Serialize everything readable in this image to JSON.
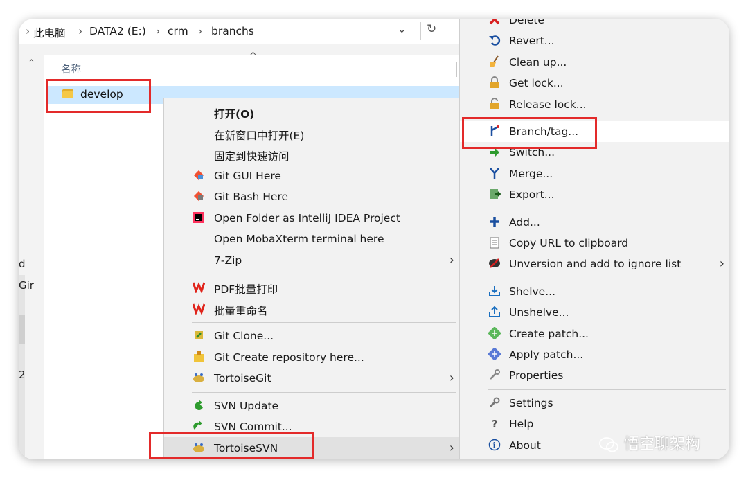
{
  "address_bar": {
    "segments": [
      "此电脑",
      "DATA2 (E:)",
      "crm",
      "branchs"
    ],
    "separator": "›",
    "dropdown_icon": "chevron-down-icon",
    "refresh_icon": "refresh-icon"
  },
  "file_list": {
    "column_name": "名称",
    "selected_item": "develop",
    "edge_chars": [
      "d",
      "Gir",
      "2"
    ]
  },
  "context_menu": {
    "groups": [
      [
        {
          "label": "打开(O)",
          "icon": "none",
          "bold": true
        },
        {
          "label": "在新窗口中打开(E)",
          "icon": "none"
        },
        {
          "label": "固定到快速访问",
          "icon": "none"
        },
        {
          "label": "Git GUI Here",
          "icon": "git-gui-icon"
        },
        {
          "label": "Git Bash Here",
          "icon": "git-bash-icon"
        },
        {
          "label": "Open Folder as IntelliJ IDEA Project",
          "icon": "intellij-icon"
        },
        {
          "label": "Open MobaXterm terminal here",
          "icon": "none"
        },
        {
          "label": "7-Zip",
          "icon": "none",
          "submenu": true
        }
      ],
      [
        {
          "label": "PDF批量打印",
          "icon": "wps-icon"
        },
        {
          "label": "批量重命名",
          "icon": "wps-icon"
        }
      ],
      [
        {
          "label": "Git Clone...",
          "icon": "tortoisegit-clone-icon"
        },
        {
          "label": "Git Create repository here...",
          "icon": "tortoisegit-repo-icon"
        },
        {
          "label": "TortoiseGit",
          "icon": "tortoisegit-icon",
          "submenu": true
        }
      ],
      [
        {
          "label": "SVN Update",
          "icon": "svn-update-icon"
        },
        {
          "label": "SVN Commit...",
          "icon": "svn-commit-icon"
        },
        {
          "label": "TortoiseSVN",
          "icon": "tortoisesvn-icon",
          "submenu": true,
          "highlighted": true
        }
      ]
    ]
  },
  "svn_submenu": {
    "groups": [
      [
        {
          "label": "Delete",
          "icon": "delete-icon"
        },
        {
          "label": "Revert...",
          "icon": "revert-icon"
        },
        {
          "label": "Clean up...",
          "icon": "cleanup-icon"
        },
        {
          "label": "Get lock...",
          "icon": "lock-icon"
        },
        {
          "label": "Release lock...",
          "icon": "unlock-icon"
        }
      ],
      [
        {
          "label": "Branch/tag...",
          "icon": "branch-icon",
          "highlighted": true
        },
        {
          "label": "Switch...",
          "icon": "switch-icon"
        },
        {
          "label": "Merge...",
          "icon": "merge-icon"
        },
        {
          "label": "Export...",
          "icon": "export-icon"
        }
      ],
      [
        {
          "label": "Add...",
          "icon": "add-icon"
        },
        {
          "label": "Copy URL to clipboard",
          "icon": "copy-url-icon"
        },
        {
          "label": "Unversion and add to ignore list",
          "icon": "ignore-icon",
          "submenu": true
        }
      ],
      [
        {
          "label": "Shelve...",
          "icon": "shelve-icon"
        },
        {
          "label": "Unshelve...",
          "icon": "unshelve-icon"
        },
        {
          "label": "Create patch...",
          "icon": "create-patch-icon"
        },
        {
          "label": "Apply patch...",
          "icon": "apply-patch-icon"
        },
        {
          "label": "Properties",
          "icon": "properties-icon"
        }
      ],
      [
        {
          "label": "Settings",
          "icon": "settings-icon"
        },
        {
          "label": "Help",
          "icon": "help-icon"
        },
        {
          "label": "About",
          "icon": "about-icon"
        }
      ]
    ]
  },
  "watermark": "悟空聊架构",
  "colors": {
    "selection": "#cce8ff",
    "annotation_red": "#e32a2a",
    "menu_bg": "#f2f2f2"
  }
}
